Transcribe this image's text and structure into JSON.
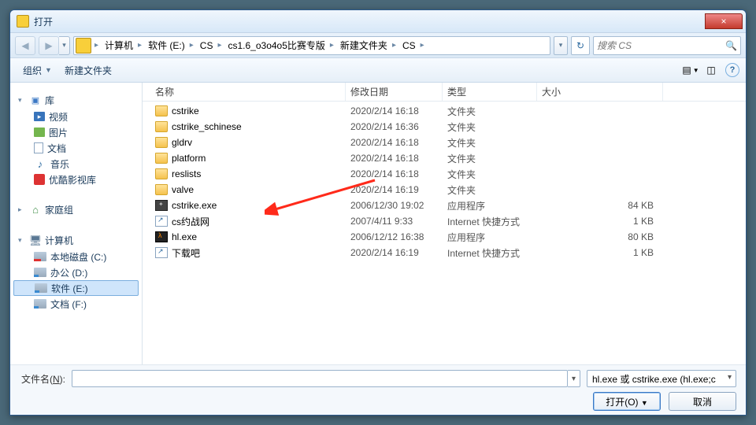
{
  "titlebar": {
    "title": "打开",
    "close": "×"
  },
  "nav": {
    "back": "◀",
    "fwd": "▶",
    "dd": "▾",
    "refresh": "↻"
  },
  "breadcrumb": {
    "items": [
      "计算机",
      "软件 (E:)",
      "CS",
      "cs1.6_o3o4o5比赛专版",
      "新建文件夹",
      "CS"
    ]
  },
  "search": {
    "placeholder": "搜索 CS",
    "icon": "🔍"
  },
  "toolbar": {
    "organize": "组织",
    "new_folder": "新建文件夹",
    "view_icon": "▤",
    "help": "?"
  },
  "sidebar": {
    "lib": {
      "label": "库",
      "items": [
        {
          "label": "视频",
          "ico": "video"
        },
        {
          "label": "图片",
          "ico": "pic"
        },
        {
          "label": "文档",
          "ico": "doc"
        },
        {
          "label": "音乐",
          "ico": "music"
        },
        {
          "label": "优酷影视库",
          "ico": "youku"
        }
      ]
    },
    "home": {
      "label": "家庭组"
    },
    "pc": {
      "label": "计算机",
      "items": [
        {
          "label": "本地磁盘 (C:)",
          "ico": "drive-c"
        },
        {
          "label": "办公 (D:)",
          "ico": "drive"
        },
        {
          "label": "软件 (E:)",
          "ico": "drive",
          "selected": true
        },
        {
          "label": "文档 (F:)",
          "ico": "drive"
        }
      ]
    }
  },
  "columns": {
    "name": "名称",
    "date": "修改日期",
    "type": "类型",
    "size": "大小"
  },
  "files": [
    {
      "name": "cstrike",
      "date": "2020/2/14 16:18",
      "type": "文件夹",
      "size": "",
      "ico": "folder"
    },
    {
      "name": "cstrike_schinese",
      "date": "2020/2/14 16:36",
      "type": "文件夹",
      "size": "",
      "ico": "folder"
    },
    {
      "name": "gldrv",
      "date": "2020/2/14 16:18",
      "type": "文件夹",
      "size": "",
      "ico": "folder"
    },
    {
      "name": "platform",
      "date": "2020/2/14 16:18",
      "type": "文件夹",
      "size": "",
      "ico": "folder"
    },
    {
      "name": "reslists",
      "date": "2020/2/14 16:18",
      "type": "文件夹",
      "size": "",
      "ico": "folder"
    },
    {
      "name": "valve",
      "date": "2020/2/14 16:19",
      "type": "文件夹",
      "size": "",
      "ico": "folder"
    },
    {
      "name": "cstrike.exe",
      "date": "2006/12/30 19:02",
      "type": "应用程序",
      "size": "84 KB",
      "ico": "cs"
    },
    {
      "name": "cs约战网",
      "date": "2007/4/11 9:33",
      "type": "Internet 快捷方式",
      "size": "1 KB",
      "ico": "url"
    },
    {
      "name": "hl.exe",
      "date": "2006/12/12 16:38",
      "type": "应用程序",
      "size": "80 KB",
      "ico": "hl"
    },
    {
      "name": "下载吧",
      "date": "2020/2/14 16:19",
      "type": "Internet 快捷方式",
      "size": "1 KB",
      "ico": "url"
    }
  ],
  "footer": {
    "filename_label_pre": "文件名(",
    "filename_label_u": "N",
    "filename_label_post": "):",
    "filename_value": "",
    "filter": "hl.exe 或 cstrike.exe (hl.exe;c",
    "open": "打开(O)",
    "cancel": "取消"
  }
}
